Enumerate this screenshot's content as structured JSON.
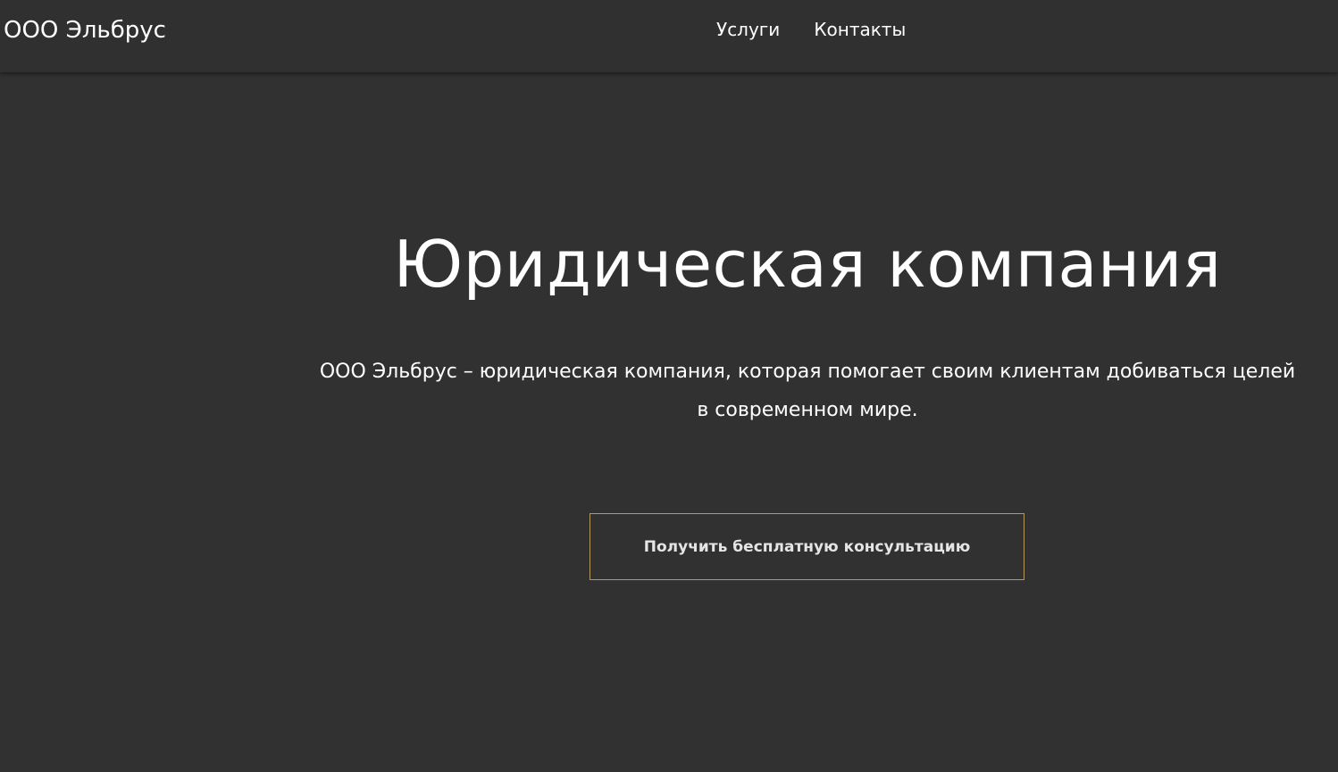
{
  "header": {
    "logo": "ООО Эльбрус",
    "nav": [
      {
        "label": "Услуги"
      },
      {
        "label": "Контакты"
      }
    ]
  },
  "hero": {
    "title": "Юридическая компания",
    "description": "ООО Эльбрус – юридическая компания, которая помогает своим клиентам добиваться целей в современном мире.",
    "cta_label": "Получить бесплатную консультацию"
  },
  "colors": {
    "background": "#313131",
    "header_background": "#303030",
    "text": "#ffffff",
    "button_border": "#b8975f"
  }
}
